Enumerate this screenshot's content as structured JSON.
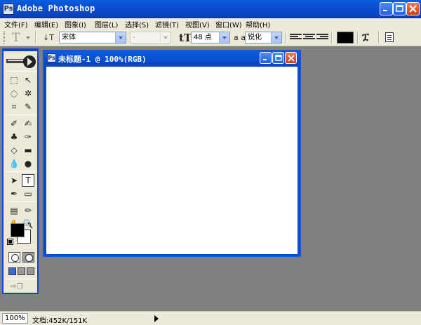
{
  "app": {
    "title": "Adobe Photoshop"
  },
  "menu": [
    "文件(F)",
    "编辑(E)",
    "图象(I)",
    "图层(L)",
    "选择(S)",
    "滤镜(T)",
    "视图(V)",
    "窗口(W)",
    "帮助(H)"
  ],
  "options": {
    "tool_preset": "T",
    "font_family": "宋体",
    "font_style": "-",
    "font_size": "48 点",
    "aa_label": "a a",
    "anti_alias": "锐化",
    "text_color": "#000000"
  },
  "document": {
    "title": "未标题-1 @ 100%(RGB)"
  },
  "toolbox": {
    "foreground": "#000000",
    "background": "#ffffff",
    "active_tool": "type-tool"
  },
  "status": {
    "zoom": "100%",
    "doc_info": "文档:452K/151K"
  }
}
